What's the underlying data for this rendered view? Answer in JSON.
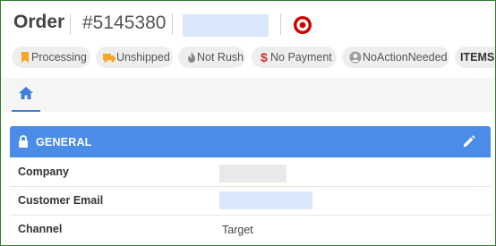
{
  "header": {
    "title": "Order",
    "order_number": "#5145380",
    "brand_icon": "target-bullseye-icon",
    "brand_color": "#cc0000"
  },
  "status_pills": [
    {
      "label": "Processing",
      "icon": "bookmark-icon",
      "icon_color": "#f5a623"
    },
    {
      "label": "Unshipped",
      "icon": "truck-icon",
      "icon_color": "#f5a623"
    },
    {
      "label": "Not Rush",
      "icon": "fire-icon",
      "icon_color": "#888888"
    },
    {
      "label": "No Payment",
      "icon": "dollar-icon",
      "icon_color": "#d32f2f"
    },
    {
      "label": "NoActionNeeded",
      "icon": "person-icon",
      "icon_color": "#777777"
    },
    {
      "label": "ITEMS",
      "icon": "",
      "icon_color": ""
    }
  ],
  "tabs": [
    {
      "icon": "home-icon",
      "active": true
    }
  ],
  "general": {
    "title": "GENERAL",
    "header_color": "#4a8ce8",
    "rows": [
      {
        "label": "Company",
        "value": ""
      },
      {
        "label": "Customer Email",
        "value": ""
      },
      {
        "label": "Channel",
        "value": "Target"
      }
    ]
  },
  "colors": {
    "accent": "#3d7fd6",
    "pill_bg": "#eeeeee"
  }
}
